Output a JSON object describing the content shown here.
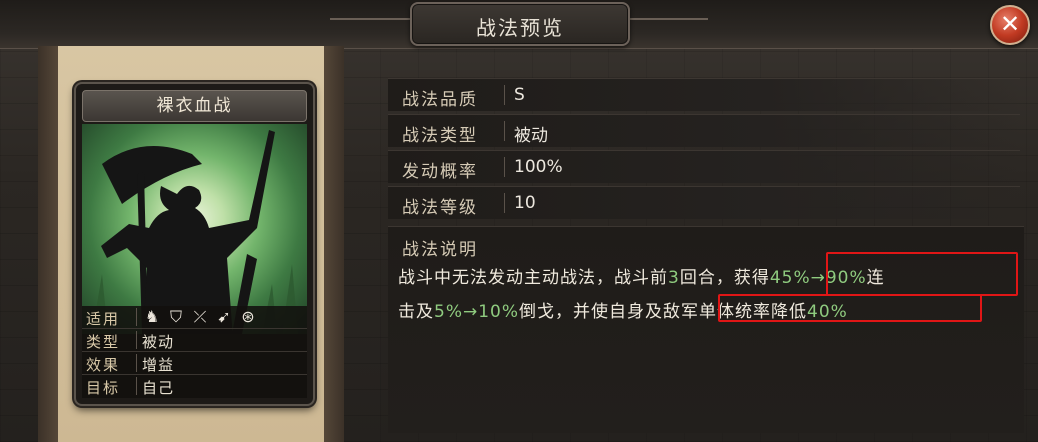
{
  "header": {
    "title": "战法预览"
  },
  "card": {
    "name": "裸衣血战",
    "stats": [
      {
        "label": "适用",
        "value": ""
      },
      {
        "label": "类型",
        "value": "被动"
      },
      {
        "label": "效果",
        "value": "增益"
      },
      {
        "label": "目标",
        "value": "自己"
      }
    ],
    "applicable_icons": [
      "cavalry-icon",
      "shield-icon",
      "bow-icon",
      "spear-icon",
      "wheel-icon"
    ]
  },
  "info": [
    {
      "label": "战法品质",
      "value": "S"
    },
    {
      "label": "战法类型",
      "value": "被动"
    },
    {
      "label": "发动概率",
      "value": "100%"
    },
    {
      "label": "战法等级",
      "value": "10"
    }
  ],
  "description": {
    "title": "战法说明",
    "line1": {
      "a": "战斗中无法发动主动战法，战斗前",
      "b": "3",
      "c": "回合，获得",
      "d": "45%→90%",
      "e": "连"
    },
    "line2": {
      "a": "击及",
      "b": "5%→10%",
      "c": "倒戈，并使自身及",
      "d": "敌军单体统率降低",
      "e": "40%"
    }
  },
  "colors": {
    "highlight": "#e01616",
    "green_text": "#8fcb7f"
  }
}
